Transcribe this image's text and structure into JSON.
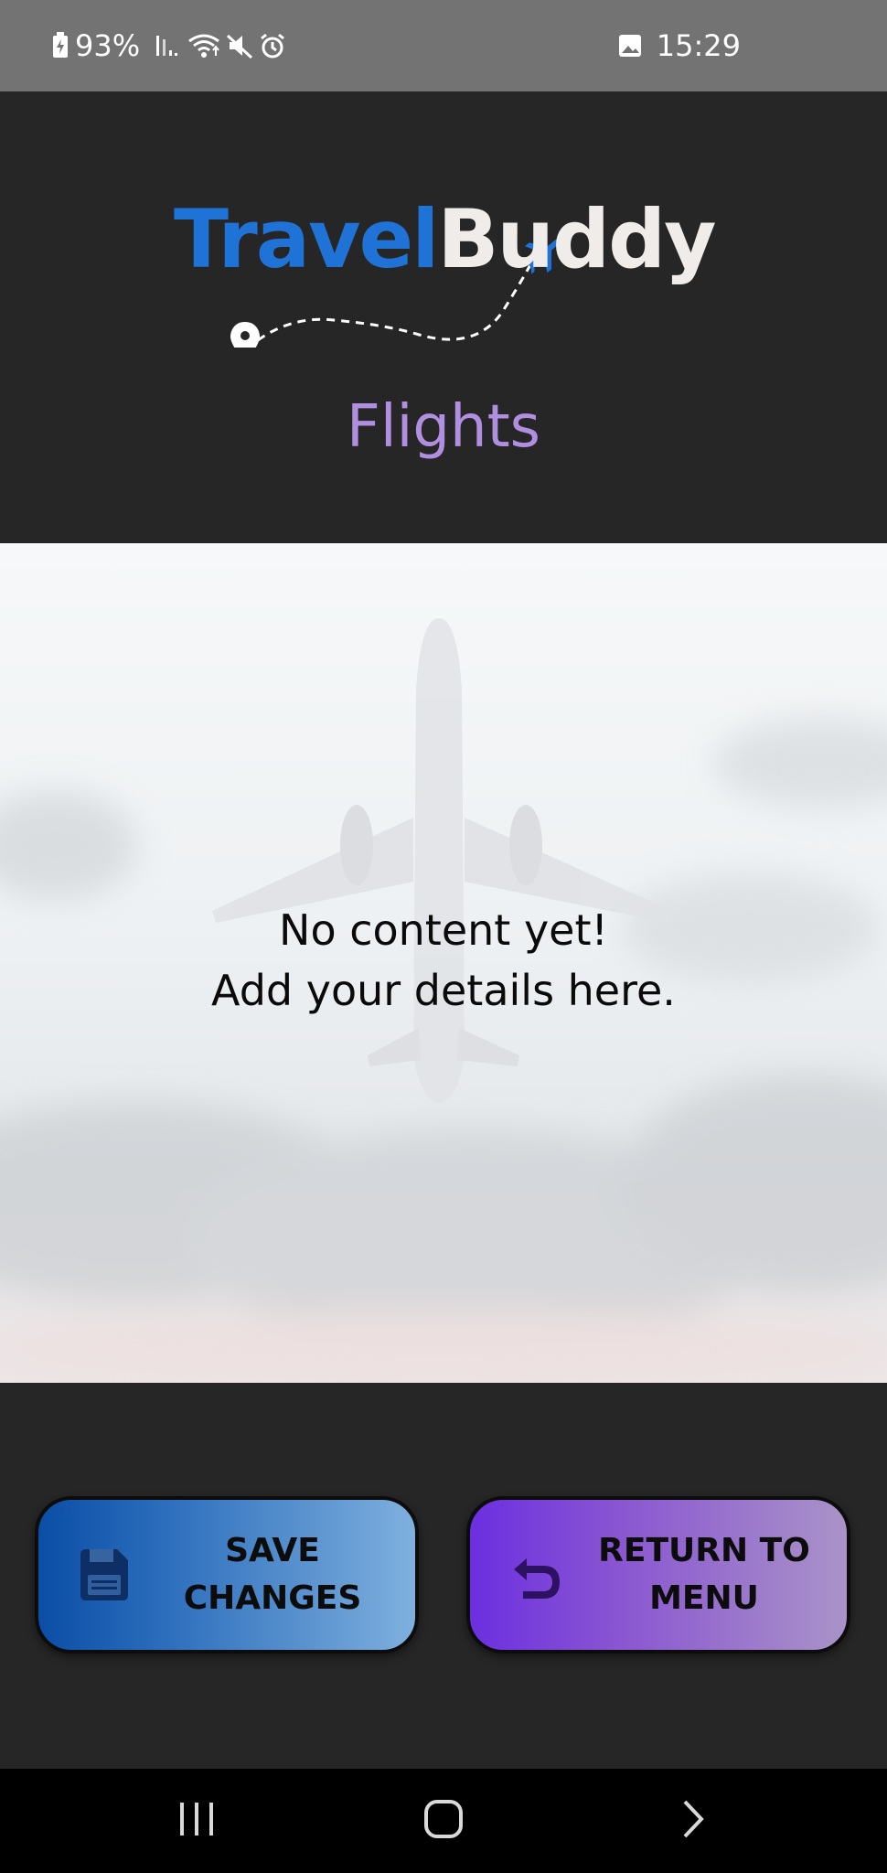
{
  "status_bar": {
    "battery": "93%",
    "time": "15:29",
    "icons": [
      "battery-charging-icon",
      "signal-icon",
      "wifi-icon",
      "mute-icon",
      "alarm-icon",
      "gallery-icon"
    ]
  },
  "header": {
    "logo": {
      "part1": "Travel",
      "part2": "Buddy",
      "colors": {
        "travel": "#1f73d6",
        "buddy": "#f0ecea"
      }
    },
    "title": "Flights",
    "title_color": "#b18fe0"
  },
  "content": {
    "empty_line1": "No content yet!",
    "empty_line2": "Add your details here."
  },
  "actions": {
    "save": {
      "line1": "SAVE",
      "line2": "CHANGES",
      "icon": "save-icon"
    },
    "return": {
      "line1": "RETURN TO",
      "line2": "MENU",
      "icon": "undo-icon"
    }
  },
  "nav_bar": {
    "buttons": [
      "recents-icon",
      "home-icon",
      "back-icon"
    ]
  }
}
